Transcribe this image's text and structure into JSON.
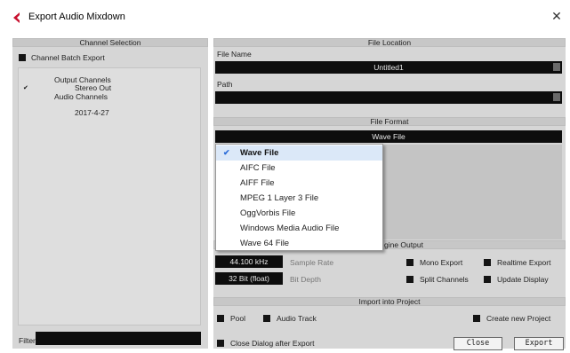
{
  "window": {
    "title": "Export Audio Mixdown",
    "close_glyph": "✕"
  },
  "channel_selection": {
    "header": "Channel Selection",
    "batch_export_label": "Channel Batch Export",
    "tree": [
      {
        "label": "Output Channels",
        "checked": false
      },
      {
        "label": "Stereo Out",
        "checked": true
      },
      {
        "label": "Audio Channels",
        "checked": false
      },
      {
        "label": "2017-4-27",
        "checked": false
      }
    ],
    "check_glyph": "✔",
    "filter_label": "Filter"
  },
  "file_location": {
    "header": "File Location",
    "file_name_label": "File Name",
    "file_name_value": "Untitled1",
    "path_label": "Path",
    "path_value": ""
  },
  "file_format": {
    "header": "File Format",
    "selected": "Wave File",
    "options": [
      "Wave File",
      "AIFC File",
      "AIFF File",
      "MPEG 1 Layer 3 File",
      "OggVorbis File",
      "Windows Media Audio File",
      "Wave 64 File"
    ],
    "check_glyph": "✔"
  },
  "audio_engine": {
    "header_partial": "gine Output",
    "sample_rate_value": "44.100 kHz",
    "sample_rate_label": "Sample Rate",
    "bit_depth_value": "32 Bit (float)",
    "bit_depth_label": "Bit Depth",
    "mono_export": "Mono Export",
    "realtime_export": "Realtime Export",
    "split_channels": "Split Channels",
    "update_display": "Update Display"
  },
  "import_into_project": {
    "header": "Import into Project",
    "pool": "Pool",
    "audio_track": "Audio Track",
    "create_new_project": "Create new Project"
  },
  "footer": {
    "close_dialog_after_export": "Close Dialog after Export",
    "close_button": "Close",
    "export_button": "Export"
  },
  "colors": {
    "accent": "#c8102e",
    "panel": "#d6d6d6",
    "dark_field": "#0d0d0d",
    "selected_row": "#dbe8f8"
  }
}
